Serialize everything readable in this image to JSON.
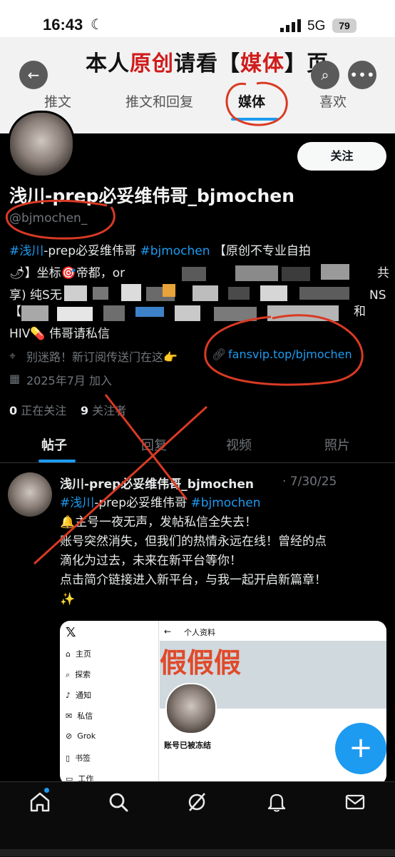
{
  "status_bar": {
    "time": "16:43",
    "network": "5G",
    "battery": "79"
  },
  "overlay": {
    "title_pre": "本人",
    "title_red1": "原创",
    "title_mid": "请看【",
    "title_red2": "媒体",
    "title_post": "】页"
  },
  "top_tabs": [
    {
      "label": "推文"
    },
    {
      "label": "推文和回复"
    },
    {
      "label": "媒体"
    },
    {
      "label": "喜欢"
    }
  ],
  "profile": {
    "follow_label": "关注",
    "display_name": "浅川-prep必妥维伟哥_bjmochen",
    "handle": "@bjmochen_",
    "bio_line1_tag1": "#浅川",
    "bio_line1_text": "-prep必妥维伟哥 ",
    "bio_line1_tag2": "#bjmochen",
    "bio_line1_tail": " 【原创不专业自拍",
    "bio_line2": "🌶】坐标🎯帝都，or",
    "bio_line2_tail": "共",
    "bio_line3": "享) 纯S无",
    "bio_line3_tail": "NS",
    "bio_line4": "【",
    "bio_line4_tail": "和",
    "bio_line5": "HIV💊 伟哥请私信",
    "location": "别迷路！新订阅传送门在这👉",
    "website": "fansvip.top/bjmochen",
    "joined": "2025年7月 加入",
    "following_count": "0",
    "following_label": "正在关注",
    "followers_count": "9",
    "followers_label": "关注者"
  },
  "profile_tabs": [
    {
      "label": "帖子"
    },
    {
      "label": "回复"
    },
    {
      "label": "视频"
    },
    {
      "label": "照片"
    }
  ],
  "tweet": {
    "author": "浅川-prep必妥维伟哥_bjmochen",
    "date": "· 7/30/25",
    "tag1": "#浅川",
    "tag_mid": "-prep必妥维伟哥 ",
    "tag2": "#bjmochen",
    "line2": "🔔主号一夜无声，发帖私信全失去！",
    "line3": "账号突然消失，但我们的热情永远在线！曾经的点",
    "line4": "滴化为过去，未来在新平台等你！",
    "line5": "点击简介链接进入新平台，与我一起开启新篇章！",
    "line6": "✨"
  },
  "embed": {
    "nav": [
      {
        "icon": "⌂",
        "label": "主页"
      },
      {
        "icon": "⌕",
        "label": "探索"
      },
      {
        "icon": "♪",
        "label": "通知"
      },
      {
        "icon": "✉",
        "label": "私信"
      },
      {
        "icon": "⊘",
        "label": "Grok"
      },
      {
        "icon": "▯",
        "label": "书签"
      },
      {
        "icon": "▭",
        "label": "工作"
      }
    ],
    "back": "←",
    "title": "个人资料",
    "overlay_text": "假假假",
    "frozen": "账号已被冻结"
  },
  "colors": {
    "accent": "#1d9bf0",
    "annotation_red": "#d93a24",
    "background": "#000000"
  }
}
